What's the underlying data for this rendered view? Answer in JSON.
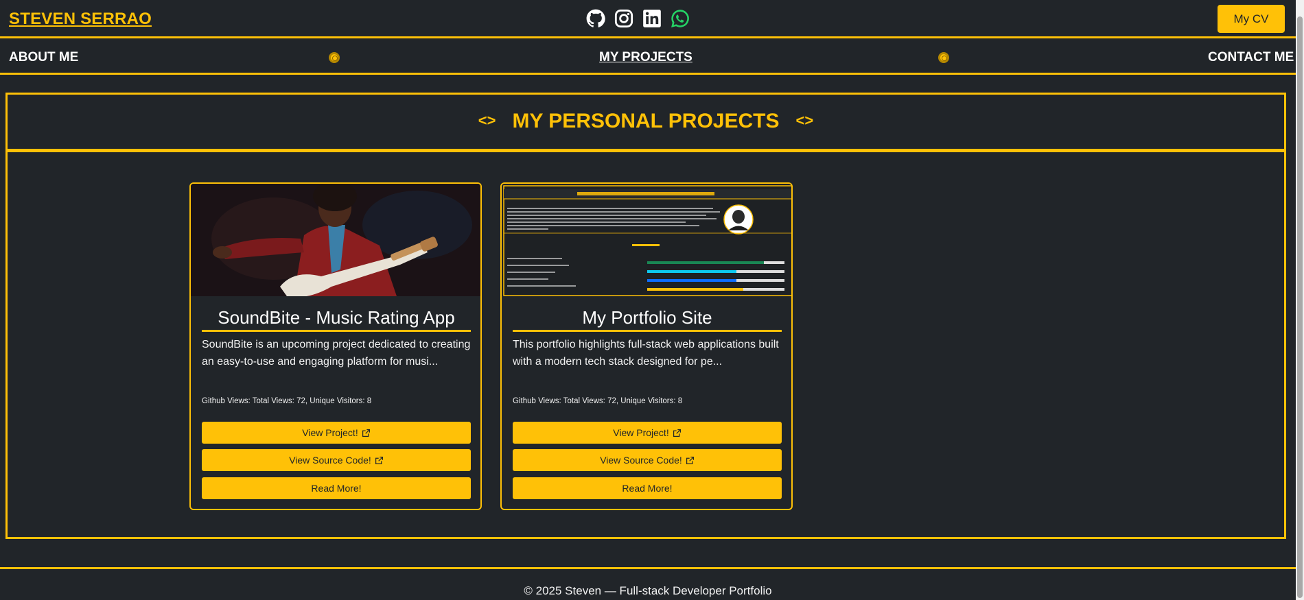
{
  "header": {
    "brand": "STEVEN SERRAO",
    "socials": [
      {
        "icon": "github-icon",
        "color": "#ffffff"
      },
      {
        "icon": "instagram-icon",
        "color": "#ffffff"
      },
      {
        "icon": "linkedin-icon",
        "color": "#ffffff"
      },
      {
        "icon": "whatsapp-icon",
        "color": "#25d366"
      }
    ],
    "cv_label": "My CV"
  },
  "nav": {
    "items": [
      {
        "label": "ABOUT ME",
        "active": false
      },
      {
        "label": "MY PROJECTS",
        "active": true
      },
      {
        "label": "CONTACT ME",
        "active": false
      }
    ]
  },
  "section": {
    "title": "MY PERSONAL PROJECTS"
  },
  "projects": [
    {
      "title": "SoundBite - Music Rating App",
      "description": "SoundBite is an upcoming project dedicated to creating an easy-to-use and engaging platform for musi...",
      "views": "Github Views: Total Views: 72, Unique Visitors: 8",
      "buttons": {
        "view_project": "View Project!",
        "view_source": "View Source Code!",
        "read_more": "Read More!"
      }
    },
    {
      "title": "My Portfolio Site",
      "description": "This portfolio highlights full-stack web applications built with a modern tech stack designed for pe...",
      "views": "Github Views: Total Views: 72, Unique Visitors: 8",
      "buttons": {
        "view_project": "View Project!",
        "view_source": "View Source Code!",
        "read_more": "Read More!"
      }
    }
  ],
  "footer": {
    "text": "© 2025 Steven — Full-stack Developer Portfolio"
  },
  "colors": {
    "accent": "#ffc107",
    "background": "#212529"
  }
}
